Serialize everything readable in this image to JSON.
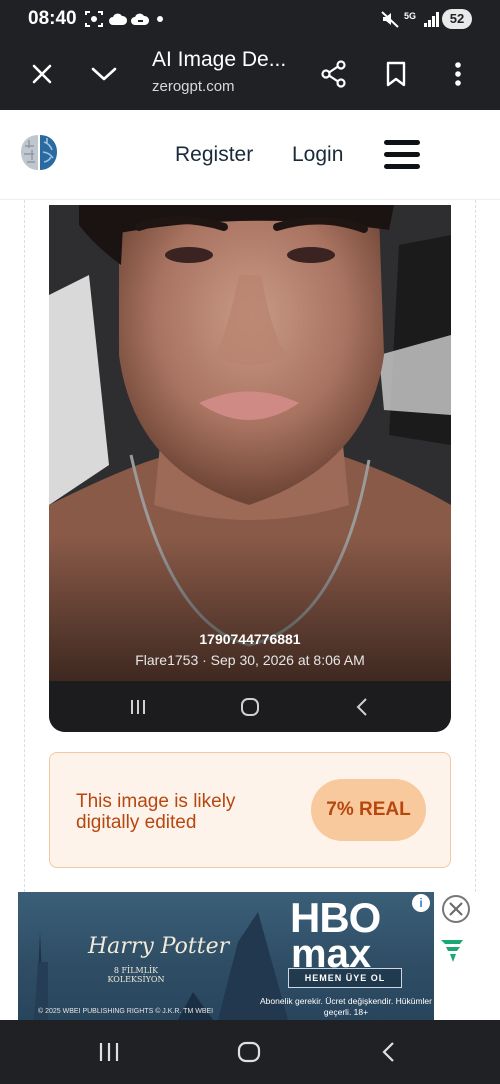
{
  "status_bar": {
    "time": "08:40",
    "network": "5G",
    "battery": "52"
  },
  "toolbar": {
    "title": "AI Image De...",
    "url": "zerogpt.com"
  },
  "header": {
    "register": "Register",
    "login": "Login"
  },
  "screenshot": {
    "image_id": "1790744776881",
    "meta": "Flare1753 · Sep 30, 2026 at 8:06 AM"
  },
  "result": {
    "message": "This image is likely digitally edited",
    "badge": "7% REAL"
  },
  "ad": {
    "title": "Harry Potter",
    "subtitle": "8 FİLMLİK KOLEKSİYON",
    "brand_top": "HBO",
    "brand_bottom": "max",
    "cta": "HEMEN ÜYE OL",
    "disclaimer": "Abonelik gerekir. Ücret değişkendir. Hükümler geçerli. 18+",
    "copyright": "© 2025 WBEI PUBLISHING RIGHTS © J.K.R. TM WBEI"
  },
  "colors": {
    "system_bar": "#1f2124",
    "result_text": "#b8470f",
    "result_bg": "#fdf3ea",
    "badge_bg": "#f8c99c",
    "brand_blue": "#2a6aa0"
  }
}
